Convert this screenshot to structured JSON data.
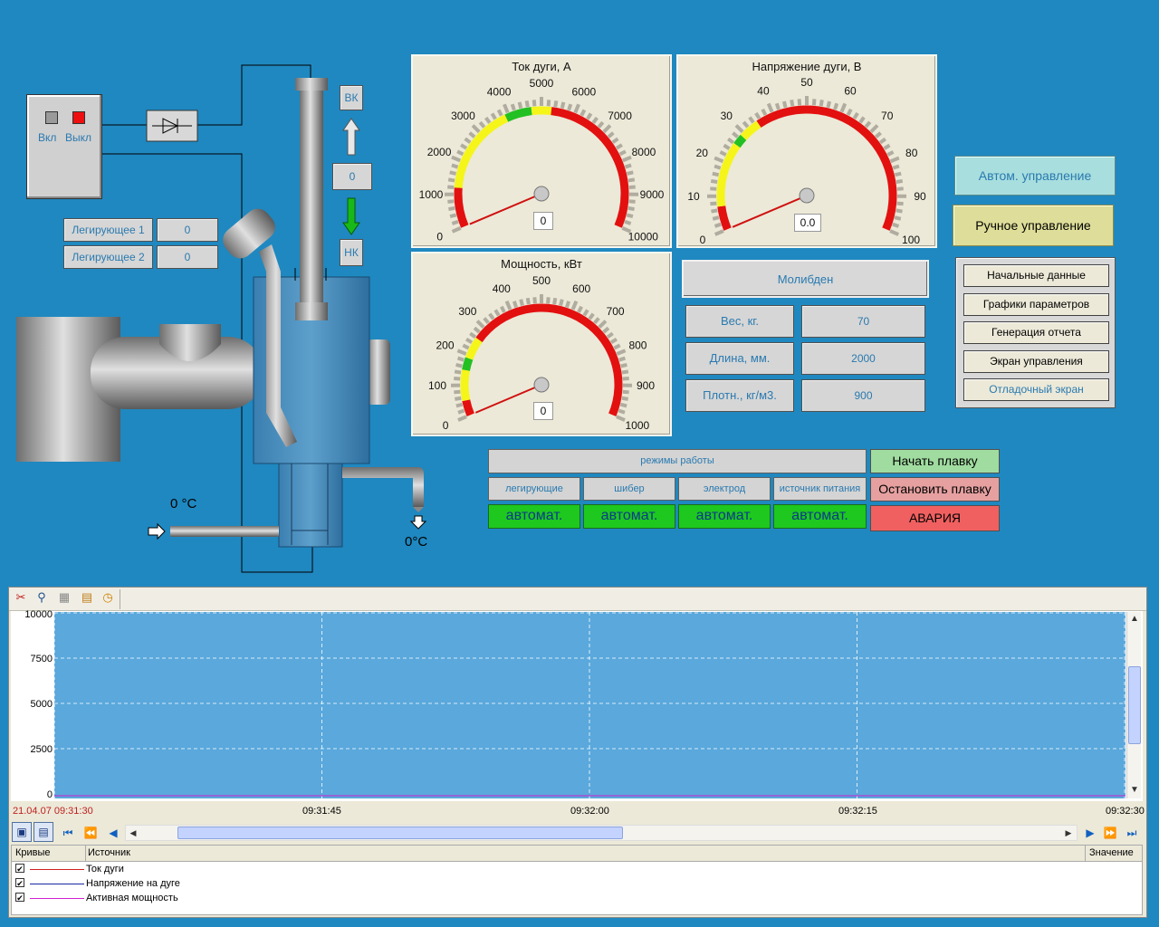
{
  "power_switch": {
    "on_label": "Вкл",
    "off_label": "Выкл"
  },
  "alloy": {
    "a1_label": "Легирующее 1",
    "a1_value": "0",
    "a2_label": "Легирующее 2",
    "a2_value": "0"
  },
  "electrode": {
    "top_label": "ВК",
    "position_value": "0",
    "bottom_label": "НК"
  },
  "temperatures": {
    "inlet": "0 °C",
    "outlet": "0°C"
  },
  "gauges": {
    "current": {
      "title": "Ток дуги, А",
      "value": "0",
      "ticks": [
        "0",
        "1000",
        "2000",
        "3000",
        "4000",
        "5000",
        "6000",
        "7000",
        "8000",
        "9000",
        "10000"
      ]
    },
    "voltage": {
      "title": "Напряжение дуги, В",
      "value": "0.0",
      "ticks": [
        "0",
        "10",
        "20",
        "30",
        "40",
        "50",
        "60",
        "70",
        "80",
        "90",
        "100"
      ]
    },
    "power": {
      "title": "Мощность, кВт",
      "value": "0",
      "ticks": [
        "0",
        "100",
        "200",
        "300",
        "400",
        "500",
        "600",
        "700",
        "800",
        "900",
        "1000"
      ]
    }
  },
  "material": {
    "name": "Молибден",
    "weight_label": "Вес, кг.",
    "weight_value": "70",
    "length_label": "Длина, мм.",
    "length_value": "2000",
    "density_label": "Плотн., кг/м3.",
    "density_value": "900"
  },
  "control": {
    "auto_label": "Автом. управление",
    "manual_label": "Ручное управление"
  },
  "menu": {
    "items": [
      "Начальные данные",
      "Графики параметров",
      "Генерация отчета",
      "Экран управления",
      "Отладочный экран"
    ]
  },
  "modes": {
    "header": "режимы работы",
    "columns": [
      {
        "label": "легирующие",
        "value": "автомат."
      },
      {
        "label": "шибер",
        "value": "автомат."
      },
      {
        "label": "электрод",
        "value": "автомат."
      },
      {
        "label": "источник питания",
        "value": "автомат."
      }
    ]
  },
  "actions": {
    "start": "Начать плавку",
    "stop": "Остановить плавку",
    "alarm": "АВАРИЯ"
  },
  "trend": {
    "y_ticks": [
      "10000",
      "7500",
      "5000",
      "2500",
      "0"
    ],
    "start_label": "21.04.07 09:31:30",
    "x_ticks": [
      "09:31:45",
      "09:32:00",
      "09:32:15",
      "09:32:30"
    ],
    "legend_headers": {
      "curves": "Кривые",
      "source": "Источник",
      "value": "Значение"
    },
    "curves": [
      {
        "name": "Ток дуги",
        "color": "#d02020"
      },
      {
        "name": "Напряжение на дуге",
        "color": "#1a2aa0"
      },
      {
        "name": "Активная мощность",
        "color": "#d020d0"
      }
    ]
  },
  "colors": {
    "background": "#1f88c0",
    "gauge_red": "#e31010",
    "gauge_yellow": "#f5f51a",
    "gauge_green": "#22c022",
    "plot_area": "#5aa8dc"
  }
}
